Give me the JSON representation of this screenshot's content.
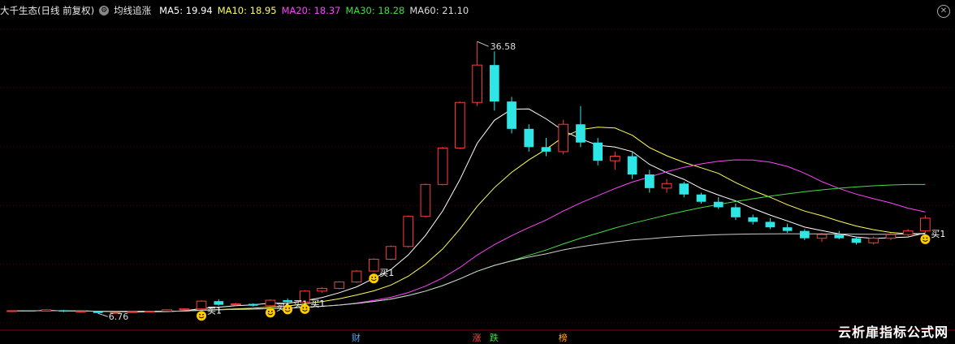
{
  "header": {
    "title": "大千生态(日线 前复权)",
    "indicator_name": "均线追涨",
    "ma": [
      {
        "label": "MA5: 19.94",
        "color": "#ffffff"
      },
      {
        "label": "MA10: 18.95",
        "color": "#ffff55"
      },
      {
        "label": "MA20: 18.37",
        "color": "#ff44ff"
      },
      {
        "label": "MA30: 18.28",
        "color": "#44dd44"
      },
      {
        "label": "MA60: 21.10",
        "color": "#dddddd"
      }
    ],
    "close_icon": "close-icon"
  },
  "watermark": "云析扉指标公式网",
  "chart_data": {
    "type": "candlestick",
    "high_label": "36.58",
    "low_label": "6.76",
    "buy_label": "买1",
    "event_markers": [
      {
        "label": "财",
        "color": "#4aa8ff",
        "index": 20
      },
      {
        "label": "涨",
        "color": "#ff4444",
        "index": 27
      },
      {
        "label": "跌",
        "color": "#44dd44",
        "index": 28
      },
      {
        "label": "榜",
        "color": "#ffaa33",
        "index": 32
      }
    ],
    "buy_signals": [
      11,
      15,
      16,
      17,
      21,
      53
    ],
    "ylim": [
      5,
      39
    ],
    "candles": [
      [
        7.0,
        7.1,
        6.9,
        7.05
      ],
      [
        7.05,
        7.1,
        6.95,
        7.0
      ],
      [
        7.0,
        7.2,
        6.95,
        7.15
      ],
      [
        7.1,
        7.15,
        6.9,
        6.95
      ],
      [
        6.95,
        7.05,
        6.85,
        7.0
      ],
      [
        7.0,
        7.0,
        6.76,
        6.8
      ],
      [
        6.8,
        6.9,
        6.76,
        6.85
      ],
      [
        6.85,
        7.0,
        6.8,
        6.95
      ],
      [
        6.95,
        7.05,
        6.85,
        7.0
      ],
      [
        7.0,
        7.2,
        6.95,
        7.15
      ],
      [
        7.15,
        7.3,
        7.1,
        7.25
      ],
      [
        7.25,
        8.2,
        7.2,
        8.1
      ],
      [
        8.1,
        8.3,
        7.6,
        7.7
      ],
      [
        7.7,
        7.9,
        7.6,
        7.8
      ],
      [
        7.8,
        7.85,
        7.5,
        7.6
      ],
      [
        7.6,
        8.3,
        7.55,
        8.2
      ],
      [
        8.2,
        8.4,
        7.9,
        8.0
      ],
      [
        8.0,
        9.3,
        7.95,
        9.2
      ],
      [
        9.2,
        9.6,
        9.0,
        9.5
      ],
      [
        9.5,
        10.3,
        9.4,
        10.2
      ],
      [
        10.2,
        11.5,
        10.1,
        11.4
      ],
      [
        11.4,
        12.8,
        11.3,
        12.7
      ],
      [
        12.7,
        14.2,
        12.6,
        14.1
      ],
      [
        14.1,
        17.5,
        14.0,
        17.4
      ],
      [
        17.4,
        21.0,
        17.3,
        20.9
      ],
      [
        20.9,
        25.0,
        20.8,
        24.9
      ],
      [
        24.9,
        30.0,
        24.8,
        29.9
      ],
      [
        29.9,
        36.58,
        29.5,
        34.0
      ],
      [
        34.0,
        35.5,
        29.0,
        30.0
      ],
      [
        30.0,
        30.5,
        26.5,
        27.0
      ],
      [
        27.0,
        27.5,
        24.5,
        25.0
      ],
      [
        25.0,
        26.0,
        24.0,
        24.5
      ],
      [
        24.5,
        28.0,
        24.2,
        27.5
      ],
      [
        27.5,
        29.5,
        25.0,
        25.5
      ],
      [
        25.5,
        26.0,
        23.0,
        23.5
      ],
      [
        23.5,
        24.5,
        22.5,
        24.0
      ],
      [
        24.0,
        24.5,
        21.5,
        22.0
      ],
      [
        22.0,
        22.5,
        20.0,
        20.5
      ],
      [
        20.5,
        21.5,
        20.0,
        21.0
      ],
      [
        21.0,
        21.2,
        19.5,
        19.8
      ],
      [
        19.8,
        20.0,
        18.8,
        19.0
      ],
      [
        19.0,
        19.5,
        18.2,
        18.4
      ],
      [
        18.4,
        18.8,
        17.0,
        17.3
      ],
      [
        17.3,
        17.6,
        16.5,
        16.8
      ],
      [
        16.8,
        17.2,
        16.0,
        16.2
      ],
      [
        16.2,
        16.6,
        15.6,
        15.8
      ],
      [
        15.8,
        16.0,
        14.8,
        15.0
      ],
      [
        15.0,
        15.6,
        14.6,
        15.4
      ],
      [
        15.4,
        15.8,
        14.9,
        15.0
      ],
      [
        15.0,
        15.2,
        14.3,
        14.5
      ],
      [
        14.5,
        15.2,
        14.3,
        15.0
      ],
      [
        15.0,
        15.6,
        14.8,
        15.4
      ],
      [
        15.4,
        16.0,
        15.2,
        15.8
      ],
      [
        15.8,
        17.5,
        15.6,
        17.2
      ]
    ]
  }
}
